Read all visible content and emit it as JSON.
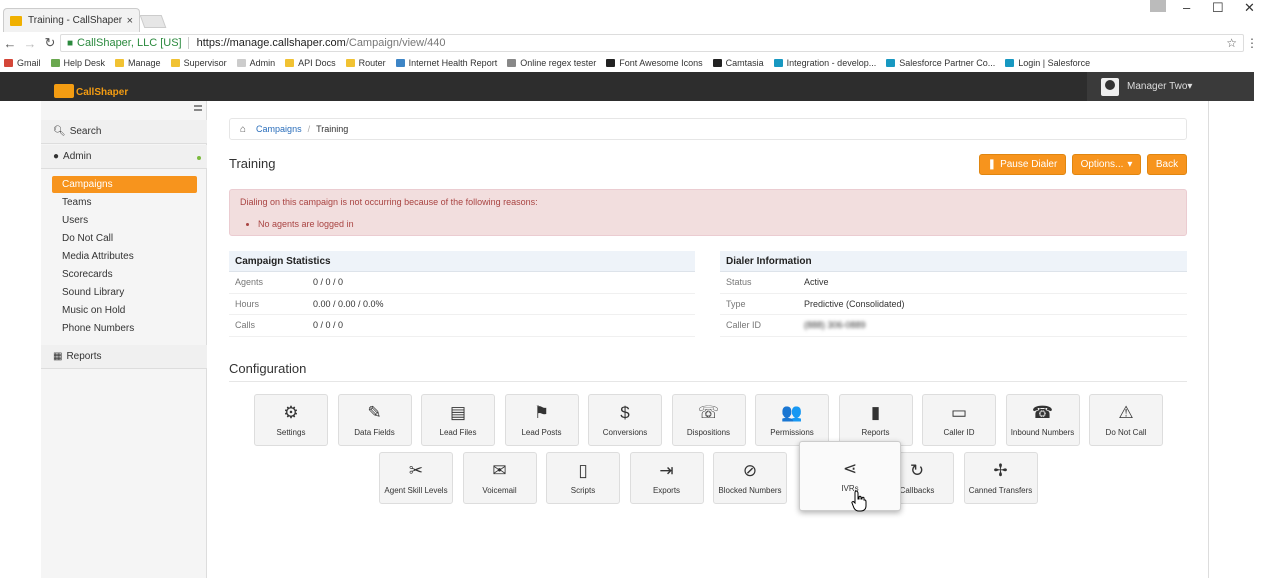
{
  "browser": {
    "tab_title": "Training - CallShaper CD",
    "tab_close": "×",
    "minimize": "–",
    "maximize": "☐",
    "close": "✕",
    "back": "←",
    "forward": "→",
    "reload": "↻",
    "secure_label": "CallShaper, LLC [US]",
    "url_host": "https://manage.callshaper.com",
    "url_path": "/Campaign/view/440",
    "star": "☆",
    "kebab": "⋮",
    "bookmarks": [
      {
        "label": "Gmail",
        "color": "#d44638"
      },
      {
        "label": "Help Desk",
        "color": "#6aa84f"
      },
      {
        "label": "Manage",
        "color": "#f1c232"
      },
      {
        "label": "Supervisor",
        "color": "#f1c232"
      },
      {
        "label": "Admin",
        "color": "#cccccc"
      },
      {
        "label": "API Docs",
        "color": "#f1c232"
      },
      {
        "label": "Router",
        "color": "#f1c232"
      },
      {
        "label": "Internet Health Report",
        "color": "#3d85c6"
      },
      {
        "label": "Online regex tester",
        "color": "#888888"
      },
      {
        "label": "Font Awesome Icons",
        "color": "#222222"
      },
      {
        "label": "Camtasia",
        "color": "#222222"
      },
      {
        "label": "Integration - develop...",
        "color": "#1798c1"
      },
      {
        "label": "Salesforce Partner Co...",
        "color": "#1798c1"
      },
      {
        "label": "Login | Salesforce",
        "color": "#1798c1"
      }
    ]
  },
  "app": {
    "logo_text": "CallShaper",
    "user_name": "Manager Two",
    "user_caret": "▾"
  },
  "sidebar": {
    "search": "Search",
    "admin": "Admin",
    "reports": "Reports",
    "items": [
      {
        "label": "Campaigns",
        "active": true
      },
      {
        "label": "Teams",
        "active": false
      },
      {
        "label": "Users",
        "active": false
      },
      {
        "label": "Do Not Call",
        "active": false
      },
      {
        "label": "Media Attributes",
        "active": false
      },
      {
        "label": "Scorecards",
        "active": false
      },
      {
        "label": "Sound Library",
        "active": false
      },
      {
        "label": "Music on Hold",
        "active": false
      },
      {
        "label": "Phone Numbers",
        "active": false
      }
    ]
  },
  "breadcrumb": {
    "link": "Campaigns",
    "sep": "/",
    "current": "Training"
  },
  "page": {
    "title": "Training",
    "pause_dialer": "Pause Dialer",
    "options": "Options...",
    "back": "Back"
  },
  "alert": {
    "message": "Dialing on this campaign is not occurring because of the following reasons:",
    "reasons": [
      "No agents are logged in"
    ]
  },
  "campaign_stats": {
    "title": "Campaign Statistics",
    "rows": [
      {
        "key": "Agents",
        "value": "0 / 0 / 0"
      },
      {
        "key": "Hours",
        "value": "0.00 / 0.00 / 0.0%"
      },
      {
        "key": "Calls",
        "value": "0 / 0 / 0"
      }
    ]
  },
  "dialer_info": {
    "title": "Dialer Information",
    "rows": [
      {
        "key": "Status",
        "value": "Active"
      },
      {
        "key": "Type",
        "value": "Predictive (Consolidated)"
      },
      {
        "key": "Caller ID",
        "value": "(888) 306-0889"
      }
    ]
  },
  "configuration": {
    "title": "Configuration",
    "row1": [
      {
        "label": "Settings",
        "icon": "⚙",
        "name": "settings"
      },
      {
        "label": "Data Fields",
        "icon": "✎",
        "name": "data-fields"
      },
      {
        "label": "Lead Files",
        "icon": "▤",
        "name": "lead-files"
      },
      {
        "label": "Lead Posts",
        "icon": "⚑",
        "name": "lead-posts"
      },
      {
        "label": "Conversions",
        "icon": "$",
        "name": "conversions"
      },
      {
        "label": "Dispositions",
        "icon": "☏",
        "name": "dispositions"
      },
      {
        "label": "Permissions",
        "icon": "👥",
        "name": "permissions"
      },
      {
        "label": "Reports",
        "icon": "▮",
        "name": "reports"
      },
      {
        "label": "Caller ID",
        "icon": "▭",
        "name": "caller-id"
      },
      {
        "label": "Inbound Numbers",
        "icon": "☎",
        "name": "inbound-numbers"
      },
      {
        "label": "Do Not Call",
        "icon": "⚠",
        "name": "do-not-call"
      }
    ],
    "row2": [
      {
        "label": "Agent Skill Levels",
        "icon": "✂",
        "name": "agent-skill-levels"
      },
      {
        "label": "Voicemail",
        "icon": "✉",
        "name": "voicemail"
      },
      {
        "label": "Scripts",
        "icon": "▯",
        "name": "scripts"
      },
      {
        "label": "Exports",
        "icon": "⇥",
        "name": "exports"
      },
      {
        "label": "Blocked Numbers",
        "icon": "⊘",
        "name": "blocked-numbers"
      },
      {
        "label": "IVRs",
        "icon": "⋖",
        "name": "ivrs"
      },
      {
        "label": "Callbacks",
        "icon": "↻",
        "name": "callbacks"
      },
      {
        "label": "Canned Transfers",
        "icon": "✢",
        "name": "canned-transfers"
      }
    ]
  }
}
